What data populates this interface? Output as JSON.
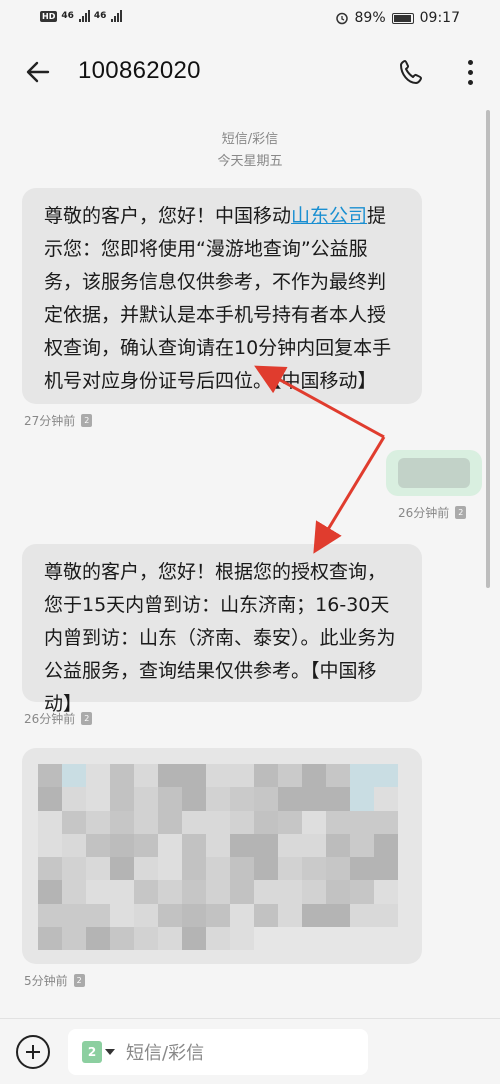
{
  "status_bar": {
    "hd": "HD",
    "net1": "46",
    "net2": "46",
    "battery": "89%",
    "time": "09:17"
  },
  "header": {
    "title": "100862020",
    "back_icon": "back-arrow-icon",
    "call_icon": "phone-icon",
    "more_icon": "more-vert-icon"
  },
  "thread": {
    "type_label": "短信/彩信",
    "day_label": "今天星期五"
  },
  "messages": [
    {
      "pre": "尊敬的客户，您好！中国移动",
      "link": "山东公司",
      "post": "提示您：您即将使用“漫游地查询”公益服务，该服务信息仅供参考，不作为最终判定依据，并默认是本手机号持有者本人授权查询，确认查询请在10分钟内回复本手机号对应身份证号后四位。【中国移动】",
      "time": "27分钟前"
    },
    {
      "sent": true,
      "time": "26分钟前"
    },
    {
      "text": "尊敬的客户，您好！根据您的授权查询，您于15天内曾到访：山东济南；16-30天内曾到访：山东（济南、泰安）。此业务为公益服务，查询结果仅供参考。【中国移动】",
      "time": "26分钟前"
    },
    {
      "obscured": true,
      "time": "5分钟前"
    }
  ],
  "composer": {
    "add_icon": "plus-circle-icon",
    "sim": "2",
    "placeholder": "短信/彩信"
  },
  "colors": {
    "link": "#1a8fd1",
    "annotation_arrow": "#e03c2e",
    "bubble": "#e6e6e6"
  }
}
